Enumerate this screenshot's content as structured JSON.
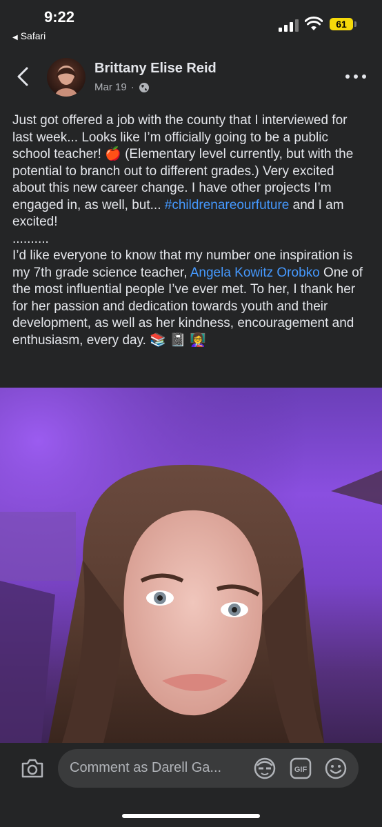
{
  "status_bar": {
    "time": "9:22",
    "back_app": "Safari",
    "battery": "61",
    "icons": [
      "back-triangle-icon",
      "signal-icon",
      "wifi-icon",
      "battery-icon"
    ]
  },
  "post": {
    "author": "Brittany Elise Reid",
    "date": "Mar 19",
    "separator": "·",
    "icons": [
      "back-chevron-icon",
      "globe-icon",
      "more-icon"
    ],
    "text": {
      "para1_a": "Just got offered a job with the county that I interviewed for last week... Looks like I’m officially going to be a public school teacher! 🍎 (Elementary level currently, but with the potential to branch out to different grades.) Very excited about this new career change. I have other projects I’m engaged in, as well, but... ",
      "hashtag": "#childrenareourfuture",
      "para1_b": " and I am excited!",
      "dots": "..........",
      "para2_a": "I’d like everyone to know that my number one inspiration is my 7th grade science teacher, ",
      "mention": "Angela Kowitz Orobko",
      "para2_b": " One of the most influential people I’ve ever met. To her, I thank her for her passion and dedication towards youth and their development, as well as her kindness, encouragement and enthusiasm, every day. 📚 📓 👩‍🏫"
    },
    "photo_icon": "selfie-photo"
  },
  "comment_bar": {
    "placeholder": "Comment as Darell Ga...",
    "gif_label": "GIF",
    "icons": [
      "camera-icon",
      "avatar-sticker-icon",
      "gif-icon",
      "emoji-icon"
    ]
  },
  "colors": {
    "background": "#242526",
    "text": "#e4e6eb",
    "secondary_text": "#b0b3b8",
    "link": "#4599ff",
    "battery": "#f5d90a",
    "input": "#3a3b3c"
  }
}
